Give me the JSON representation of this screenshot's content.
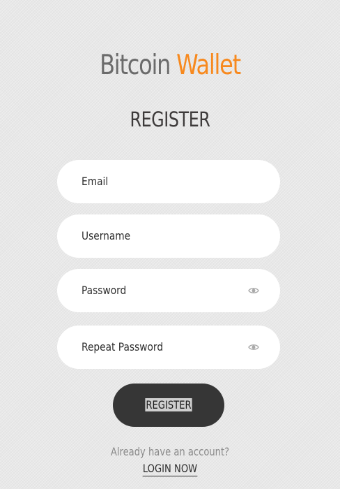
{
  "brand": {
    "part1": "Bitcoin",
    "part2": "Wallet",
    "part1_color": "#6b6b6b",
    "part2_color": "#f7891e"
  },
  "form": {
    "heading": "REGISTER",
    "fields": [
      {
        "label": "Email",
        "type": "email"
      },
      {
        "label": "Username",
        "type": "text"
      },
      {
        "label": "Password",
        "type": "password",
        "icon": "eye-icon"
      },
      {
        "label": "Repeat Password",
        "type": "password",
        "icon": "eye-icon"
      }
    ],
    "submit_label": "REGISTER",
    "submit_color": "#363636"
  },
  "footer": {
    "prompt": "Already have an account?",
    "login_label": "LOGIN NOW"
  }
}
